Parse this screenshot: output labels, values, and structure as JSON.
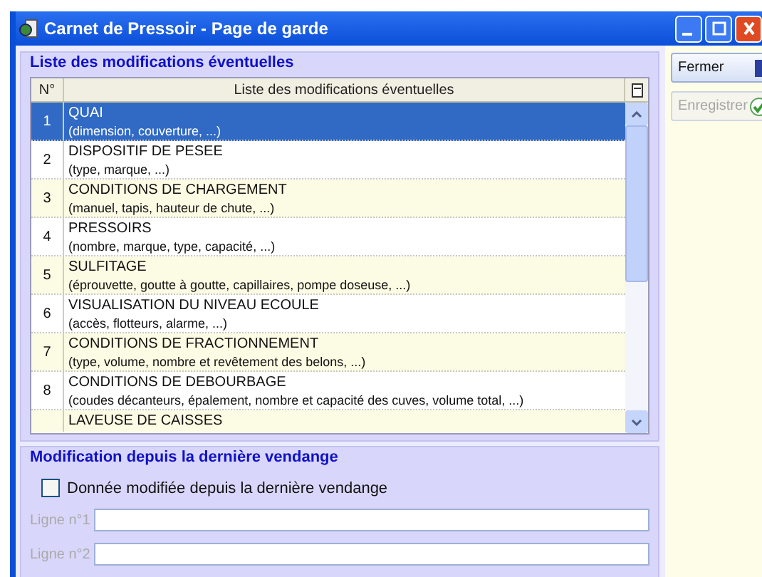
{
  "window": {
    "title": "Carnet de Pressoir - Page de garde"
  },
  "list_group": {
    "title": "Liste des modifications éventuelles",
    "columns": [
      "N°",
      "Liste des modifications éventuelles"
    ],
    "rows": [
      {
        "number": "1",
        "title": "QUAI",
        "detail": "(dimension, couverture, ...)",
        "selected": true
      },
      {
        "number": "2",
        "title": "DISPOSITIF DE PESEE",
        "detail": "(type, marque, ...)",
        "selected": false
      },
      {
        "number": "3",
        "title": "CONDITIONS DE CHARGEMENT",
        "detail": "(manuel, tapis, hauteur de chute, ...)",
        "selected": false
      },
      {
        "number": "4",
        "title": "PRESSOIRS",
        "detail": "(nombre, marque, type, capacité, ...)",
        "selected": false
      },
      {
        "number": "5",
        "title": "SULFITAGE",
        "detail": "(éprouvette, goutte à goutte, capillaires, pompe doseuse, ...)",
        "selected": false
      },
      {
        "number": "6",
        "title": "VISUALISATION DU NIVEAU ECOULE",
        "detail": "(accès, flotteurs, alarme, ...)",
        "selected": false
      },
      {
        "number": "7",
        "title": "CONDITIONS DE FRACTIONNEMENT",
        "detail": "(type, volume, nombre et revêtement des belons, ...)",
        "selected": false
      },
      {
        "number": "8",
        "title": "CONDITIONS DE DEBOURBAGE",
        "detail": "(coudes décanteurs, épalement, nombre et capacité des cuves, volume total, ...)",
        "selected": false
      },
      {
        "number": "",
        "title": "LAVEUSE DE CAISSES",
        "selected": false
      }
    ]
  },
  "modification_group": {
    "title": "Modification depuis la dernière vendange",
    "checkbox": {
      "label": "Donnée modifiée depuis la dernière vendange",
      "checked": false
    },
    "fields": [
      {
        "label": "Ligne n°1",
        "disabled": true
      },
      {
        "label": "Ligne n°2",
        "disabled": true
      }
    ]
  },
  "buttons": [
    {
      "label": "Fermer",
      "kind": "close",
      "disabled": false
    },
    {
      "label": "Enregistrer",
      "kind": "save",
      "disabled": true
    }
  ]
}
